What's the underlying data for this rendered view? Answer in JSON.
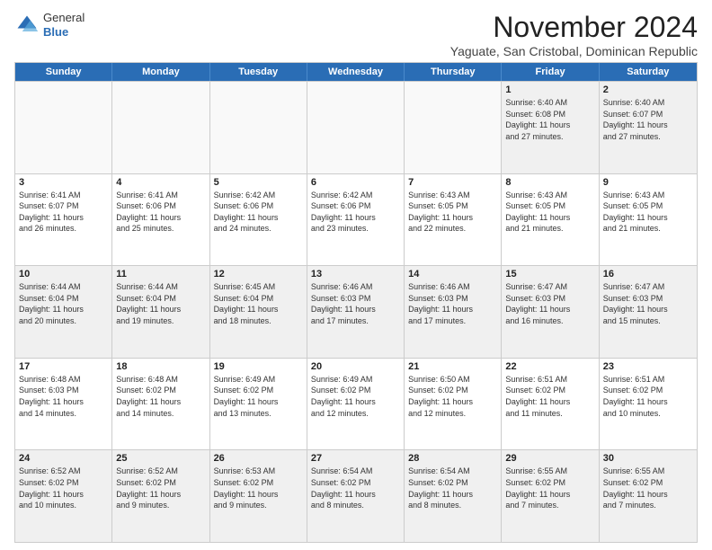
{
  "header": {
    "logo_general": "General",
    "logo_blue": "Blue",
    "month_title": "November 2024",
    "subtitle": "Yaguate, San Cristobal, Dominican Republic"
  },
  "days_of_week": [
    "Sunday",
    "Monday",
    "Tuesday",
    "Wednesday",
    "Thursday",
    "Friday",
    "Saturday"
  ],
  "weeks": [
    [
      {
        "day": "",
        "info": "",
        "empty": true
      },
      {
        "day": "",
        "info": "",
        "empty": true
      },
      {
        "day": "",
        "info": "",
        "empty": true
      },
      {
        "day": "",
        "info": "",
        "empty": true
      },
      {
        "day": "",
        "info": "",
        "empty": true
      },
      {
        "day": "1",
        "info": "Sunrise: 6:40 AM\nSunset: 6:08 PM\nDaylight: 11 hours\nand 27 minutes."
      },
      {
        "day": "2",
        "info": "Sunrise: 6:40 AM\nSunset: 6:07 PM\nDaylight: 11 hours\nand 27 minutes."
      }
    ],
    [
      {
        "day": "3",
        "info": "Sunrise: 6:41 AM\nSunset: 6:07 PM\nDaylight: 11 hours\nand 26 minutes."
      },
      {
        "day": "4",
        "info": "Sunrise: 6:41 AM\nSunset: 6:06 PM\nDaylight: 11 hours\nand 25 minutes."
      },
      {
        "day": "5",
        "info": "Sunrise: 6:42 AM\nSunset: 6:06 PM\nDaylight: 11 hours\nand 24 minutes."
      },
      {
        "day": "6",
        "info": "Sunrise: 6:42 AM\nSunset: 6:06 PM\nDaylight: 11 hours\nand 23 minutes."
      },
      {
        "day": "7",
        "info": "Sunrise: 6:43 AM\nSunset: 6:05 PM\nDaylight: 11 hours\nand 22 minutes."
      },
      {
        "day": "8",
        "info": "Sunrise: 6:43 AM\nSunset: 6:05 PM\nDaylight: 11 hours\nand 21 minutes."
      },
      {
        "day": "9",
        "info": "Sunrise: 6:43 AM\nSunset: 6:05 PM\nDaylight: 11 hours\nand 21 minutes."
      }
    ],
    [
      {
        "day": "10",
        "info": "Sunrise: 6:44 AM\nSunset: 6:04 PM\nDaylight: 11 hours\nand 20 minutes."
      },
      {
        "day": "11",
        "info": "Sunrise: 6:44 AM\nSunset: 6:04 PM\nDaylight: 11 hours\nand 19 minutes."
      },
      {
        "day": "12",
        "info": "Sunrise: 6:45 AM\nSunset: 6:04 PM\nDaylight: 11 hours\nand 18 minutes."
      },
      {
        "day": "13",
        "info": "Sunrise: 6:46 AM\nSunset: 6:03 PM\nDaylight: 11 hours\nand 17 minutes."
      },
      {
        "day": "14",
        "info": "Sunrise: 6:46 AM\nSunset: 6:03 PM\nDaylight: 11 hours\nand 17 minutes."
      },
      {
        "day": "15",
        "info": "Sunrise: 6:47 AM\nSunset: 6:03 PM\nDaylight: 11 hours\nand 16 minutes."
      },
      {
        "day": "16",
        "info": "Sunrise: 6:47 AM\nSunset: 6:03 PM\nDaylight: 11 hours\nand 15 minutes."
      }
    ],
    [
      {
        "day": "17",
        "info": "Sunrise: 6:48 AM\nSunset: 6:03 PM\nDaylight: 11 hours\nand 14 minutes."
      },
      {
        "day": "18",
        "info": "Sunrise: 6:48 AM\nSunset: 6:02 PM\nDaylight: 11 hours\nand 14 minutes."
      },
      {
        "day": "19",
        "info": "Sunrise: 6:49 AM\nSunset: 6:02 PM\nDaylight: 11 hours\nand 13 minutes."
      },
      {
        "day": "20",
        "info": "Sunrise: 6:49 AM\nSunset: 6:02 PM\nDaylight: 11 hours\nand 12 minutes."
      },
      {
        "day": "21",
        "info": "Sunrise: 6:50 AM\nSunset: 6:02 PM\nDaylight: 11 hours\nand 12 minutes."
      },
      {
        "day": "22",
        "info": "Sunrise: 6:51 AM\nSunset: 6:02 PM\nDaylight: 11 hours\nand 11 minutes."
      },
      {
        "day": "23",
        "info": "Sunrise: 6:51 AM\nSunset: 6:02 PM\nDaylight: 11 hours\nand 10 minutes."
      }
    ],
    [
      {
        "day": "24",
        "info": "Sunrise: 6:52 AM\nSunset: 6:02 PM\nDaylight: 11 hours\nand 10 minutes."
      },
      {
        "day": "25",
        "info": "Sunrise: 6:52 AM\nSunset: 6:02 PM\nDaylight: 11 hours\nand 9 minutes."
      },
      {
        "day": "26",
        "info": "Sunrise: 6:53 AM\nSunset: 6:02 PM\nDaylight: 11 hours\nand 9 minutes."
      },
      {
        "day": "27",
        "info": "Sunrise: 6:54 AM\nSunset: 6:02 PM\nDaylight: 11 hours\nand 8 minutes."
      },
      {
        "day": "28",
        "info": "Sunrise: 6:54 AM\nSunset: 6:02 PM\nDaylight: 11 hours\nand 8 minutes."
      },
      {
        "day": "29",
        "info": "Sunrise: 6:55 AM\nSunset: 6:02 PM\nDaylight: 11 hours\nand 7 minutes."
      },
      {
        "day": "30",
        "info": "Sunrise: 6:55 AM\nSunset: 6:02 PM\nDaylight: 11 hours\nand 7 minutes."
      }
    ]
  ]
}
